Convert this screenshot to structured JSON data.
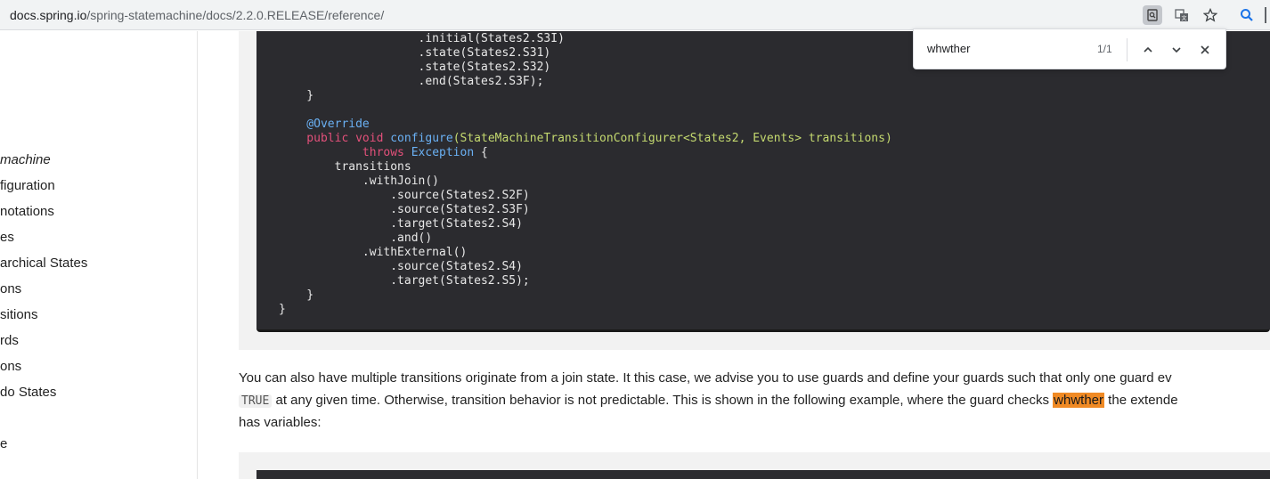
{
  "browser": {
    "url_host": "docs.spring.io",
    "url_path": "/spring-statemachine/docs/2.2.0.RELEASE/reference/"
  },
  "find_bar": {
    "query": "whwther",
    "count": "1/1"
  },
  "sidebar": {
    "items": [
      {
        "label": "machine",
        "italic": true
      },
      {
        "label": "figuration"
      },
      {
        "label": "notations"
      },
      {
        "label": "es"
      },
      {
        "label": "archical States"
      },
      {
        "label": "ons"
      },
      {
        "label": "sitions"
      },
      {
        "label": "rds"
      },
      {
        "label": "ons"
      },
      {
        "label": "do States"
      },
      {
        "label": "e"
      }
    ]
  },
  "code": {
    "lines": [
      "                    .initial(States2.S3I)",
      "                    .state(States2.S31)",
      "                    .state(States2.S32)",
      "                    .end(States2.S3F);",
      "    }",
      "",
      "    @Override",
      "    public void configure(StateMachineTransitionConfigurer<States2, Events> transitions)",
      "            throws Exception {",
      "        transitions",
      "            .withJoin()",
      "                .source(States2.S2F)",
      "                .source(States2.S3F)",
      "                .target(States2.S4)",
      "                .and()",
      "            .withExternal()",
      "                .source(States2.S4)",
      "                .target(States2.S5);",
      "    }",
      "}"
    ]
  },
  "paragraph": {
    "line1": "You can also have multiple transitions originate from a join state. It this case, we advise you to use guards and define your guards such that only one guard ev",
    "code_true": "TRUE",
    "line2_mid": " at any given time. Otherwise, transition behavior is not predictable. This is shown in the following example, where the guard checks ",
    "highlight": "whwther",
    "line2_end": " the extende",
    "line3": "has variables:"
  },
  "colors": {
    "code_bg": "#2b2b2f",
    "keyword": "#e2507a",
    "annotation": "#6ab0f3",
    "type": "#c4d96f",
    "find_highlight": "#f08a24"
  }
}
